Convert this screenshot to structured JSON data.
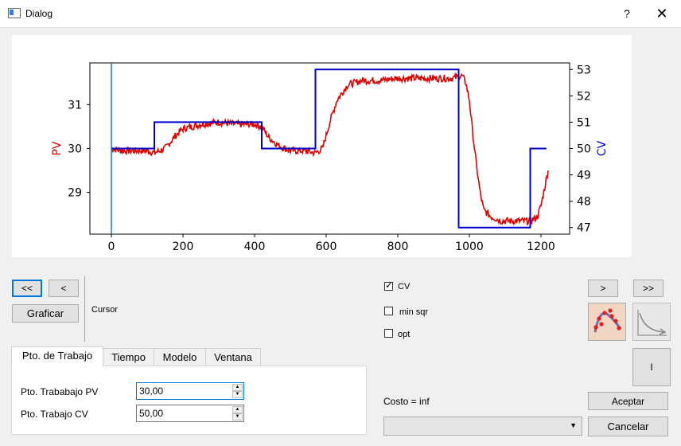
{
  "window": {
    "title": "Dialog",
    "help": "?",
    "close": "✕"
  },
  "nav": {
    "first": "<<",
    "prev": "<",
    "next": ">",
    "last": ">>"
  },
  "graficar": "Graficar",
  "cursor_label": "Cursor",
  "checkboxes": [
    {
      "label": "CV",
      "checked": true
    },
    {
      "label": "min sqr",
      "checked": false
    },
    {
      "label": "opt",
      "checked": false
    }
  ],
  "tabs": [
    "Pto. de Trabajo",
    "Tiempo",
    "Modelo",
    "Ventana"
  ],
  "fields": [
    {
      "label": "Pto. Trababajo PV",
      "value": "30,00"
    },
    {
      "label": "Pto. Trabajo CV",
      "value": "50,00"
    }
  ],
  "costo": "Costo = inf",
  "combo_value": "",
  "buttons": {
    "i": "I",
    "aceptar": "Aceptar",
    "cancelar": "Cancelar"
  },
  "chart_data": {
    "type": "line",
    "xlim": [
      -60,
      1280
    ],
    "xticks": [
      0,
      200,
      400,
      600,
      800,
      1000,
      1200
    ],
    "y_left": {
      "label": "PV",
      "color": "#e00000",
      "ylim": [
        28.05,
        31.95
      ],
      "ticks": [
        29,
        30,
        31
      ]
    },
    "y_right": {
      "label": "CV",
      "color": "#0000cc",
      "ylim": [
        46.75,
        53.25
      ],
      "ticks": [
        47,
        48,
        49,
        50,
        51,
        52,
        53
      ]
    },
    "cursor_line": {
      "x": 0,
      "color": "#1f77b4"
    },
    "series": [
      {
        "name": "PV",
        "axis": "left",
        "color": "#e00000",
        "x": [
          0,
          30,
          60,
          100,
          120,
          150,
          180,
          200,
          250,
          300,
          350,
          400,
          420,
          440,
          470,
          500,
          540,
          570,
          590,
          610,
          630,
          660,
          700,
          750,
          800,
          850,
          900,
          950,
          980,
          990,
          1000,
          1010,
          1020,
          1030,
          1040,
          1060,
          1090,
          1120,
          1150,
          1170,
          1190,
          1200,
          1210,
          1220
        ],
        "y": [
          30.0,
          29.95,
          29.95,
          29.95,
          29.9,
          30.0,
          30.3,
          30.45,
          30.55,
          30.6,
          30.55,
          30.55,
          30.5,
          30.25,
          30.05,
          29.95,
          29.95,
          29.9,
          30.0,
          30.6,
          31.1,
          31.45,
          31.55,
          31.55,
          31.6,
          31.6,
          31.6,
          31.6,
          31.65,
          31.5,
          31.1,
          30.3,
          29.6,
          29.0,
          28.6,
          28.45,
          28.35,
          28.35,
          28.35,
          28.35,
          28.45,
          28.7,
          29.1,
          29.5
        ]
      },
      {
        "name": "CV",
        "axis": "right",
        "color": "#0000cc",
        "x": [
          0,
          120,
          120,
          420,
          420,
          570,
          570,
          970,
          970,
          1170,
          1170,
          1215
        ],
        "y": [
          50,
          50,
          51,
          51,
          50,
          50,
          53,
          53,
          47,
          47,
          50,
          50
        ]
      }
    ]
  }
}
